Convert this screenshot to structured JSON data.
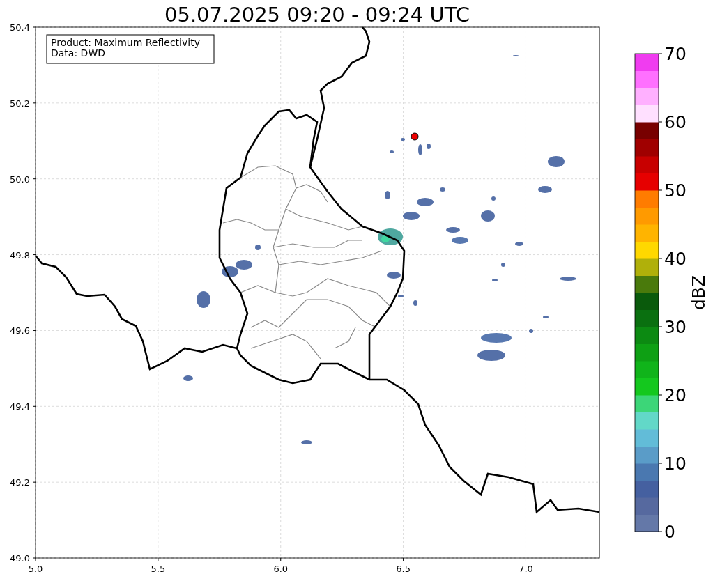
{
  "title": "05.07.2025 09:20 - 09:24 UTC",
  "info_box": [
    "Product: Maximum Reflectivity",
    "Data: DWD"
  ],
  "map": {
    "xticks": [
      "5.0",
      "5.5",
      "6.0",
      "6.5",
      "7.0"
    ],
    "yticks": [
      "50.4",
      "50.2",
      "50.0",
      "49.8",
      "49.6",
      "49.4",
      "49.2",
      "49.0"
    ]
  },
  "colorbar": {
    "label": "dBZ",
    "ticks": [
      "70",
      "60",
      "50",
      "40",
      "30",
      "20",
      "10",
      "0"
    ],
    "bands": [
      {
        "color": "#6478a8"
      },
      {
        "color": "#56699f"
      },
      {
        "color": "#4560a0"
      },
      {
        "color": "#4a78b0"
      },
      {
        "color": "#5a9cc8"
      },
      {
        "color": "#62bcd8"
      },
      {
        "color": "#62d8c8"
      },
      {
        "color": "#3cd678"
      },
      {
        "color": "#14c81e"
      },
      {
        "color": "#10b41a"
      },
      {
        "color": "#0ea014"
      },
      {
        "color": "#0c8a12"
      },
      {
        "color": "#0a7010"
      },
      {
        "color": "#0a5a0c"
      },
      {
        "color": "#4a7a0c"
      },
      {
        "color": "#b0b00a"
      },
      {
        "color": "#ffd800"
      },
      {
        "color": "#ffb400"
      },
      {
        "color": "#ff9a00"
      },
      {
        "color": "#ff7c00"
      },
      {
        "color": "#e60000"
      },
      {
        "color": "#c80000"
      },
      {
        "color": "#a00000"
      },
      {
        "color": "#780000"
      },
      {
        "color": "#ffe0ff"
      },
      {
        "color": "#ffb0ff"
      },
      {
        "color": "#ff70ff"
      },
      {
        "color": "#f03cf0"
      }
    ]
  }
}
